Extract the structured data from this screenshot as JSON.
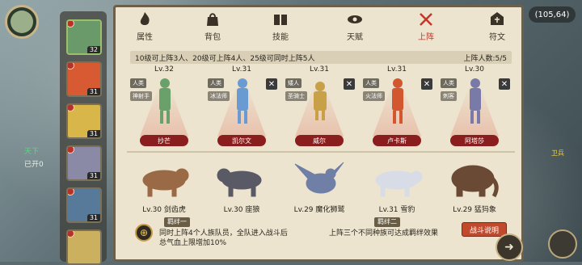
{
  "coords": "(105,64)",
  "side_text": [
    "天下",
    "已开0"
  ],
  "guard_label": "卫兵",
  "tabs": [
    {
      "label": "属性",
      "icon": "flame-icon"
    },
    {
      "label": "背包",
      "icon": "bag-icon"
    },
    {
      "label": "技能",
      "icon": "book-icon"
    },
    {
      "label": "天赋",
      "icon": "eye-icon"
    },
    {
      "label": "上阵",
      "icon": "crossed-swords-icon",
      "active": true
    },
    {
      "label": "符文",
      "icon": "rune-icon"
    }
  ],
  "info_bar": {
    "left": "10级可上阵3人、20级可上阵4人、25级可同时上阵5人",
    "right": "上阵人数:5/5"
  },
  "hero_list": [
    {
      "level": "32",
      "color": "#6a9a6a"
    },
    {
      "level": "31",
      "color": "#d75a32"
    },
    {
      "level": "31",
      "color": "#d8b64a"
    },
    {
      "level": "31",
      "color": "#8a8aa6"
    },
    {
      "level": "31",
      "color": "#587a9a"
    },
    {
      "level": "",
      "color": "#cbb060"
    }
  ],
  "heroes": [
    {
      "level": "Lv.32",
      "tag1": "人类",
      "tag2": "神射手",
      "name": "抄芒",
      "color": "#6aa06a",
      "removable": false
    },
    {
      "level": "Lv.31",
      "tag1": "人类",
      "tag2": "冰法师",
      "name": "凯尔文",
      "color": "#6a9ad2",
      "removable": true
    },
    {
      "level": "Lv.31",
      "tag1": "矮人",
      "tag2": "圣骑士",
      "name": "威尔",
      "color": "#c8a048",
      "removable": true
    },
    {
      "level": "Lv.31",
      "tag1": "人类",
      "tag2": "火法师",
      "name": "卢卡斯",
      "color": "#d2562e",
      "removable": true
    },
    {
      "level": "Lv.30",
      "tag1": "人类",
      "tag2": "刺客",
      "name": "阿塔莎",
      "color": "#7a7aa8",
      "removable": true
    }
  ],
  "pets": [
    {
      "label": "Lv.30 剑齿虎",
      "color": "#9a6a46"
    },
    {
      "label": "Lv.30 座狼",
      "color": "#5a5a66"
    },
    {
      "label": "Lv.29 魔化狮鹫",
      "color": "#6f7fa6"
    },
    {
      "label": "Lv.31 雪豹",
      "color": "#d8dce6"
    },
    {
      "label": "Lv.29 猛犸象",
      "color": "#6a4a34"
    }
  ],
  "bonds": [
    {
      "title": "羁绊一",
      "text": [
        "同时上阵4个人族队员，全队进入战斗后",
        "总气血上限增加10%"
      ],
      "icon": "crosshair-icon"
    },
    {
      "title": "羁绊二",
      "text": [
        "上阵三个不同种族可达成羁绊效果"
      ]
    }
  ],
  "battle_button": "战斗说明"
}
